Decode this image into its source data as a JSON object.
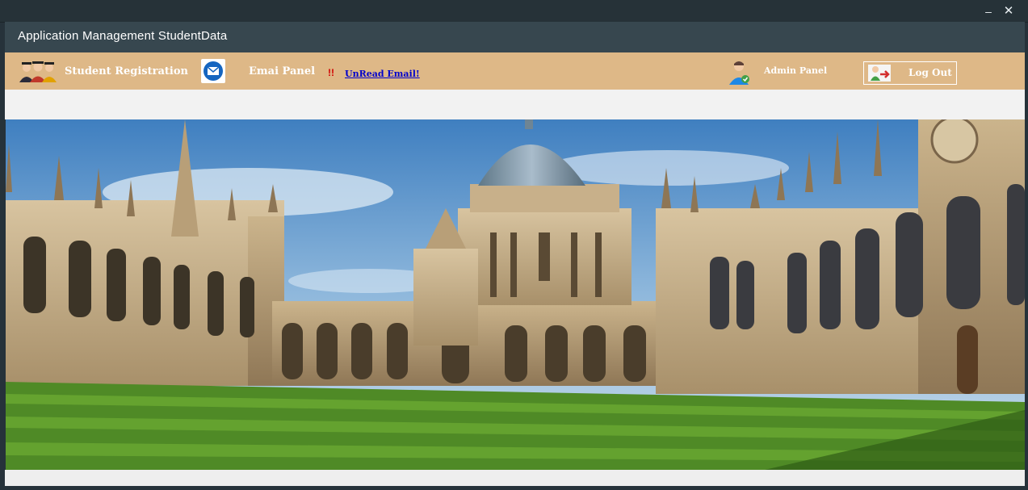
{
  "window": {
    "minimize_label": "–",
    "close_label": "✕"
  },
  "app": {
    "title": "Application Management StudentData"
  },
  "menu": {
    "student_registration": "Student Registration",
    "email_panel": "Emai Panel",
    "alert_mark": "!!",
    "unread_email": "UnRead Email!",
    "admin_panel": "Admin Panel",
    "logout": "Log Out"
  },
  "icons": {
    "students": "students-group-icon",
    "mail": "envelope-icon",
    "admin": "admin-user-icon",
    "logout": "logout-icon"
  },
  "colors": {
    "titlebar": "#263238",
    "header": "#37474f",
    "menubar": "#deb887",
    "unread_link": "#0000cc",
    "alert": "#d10000"
  }
}
